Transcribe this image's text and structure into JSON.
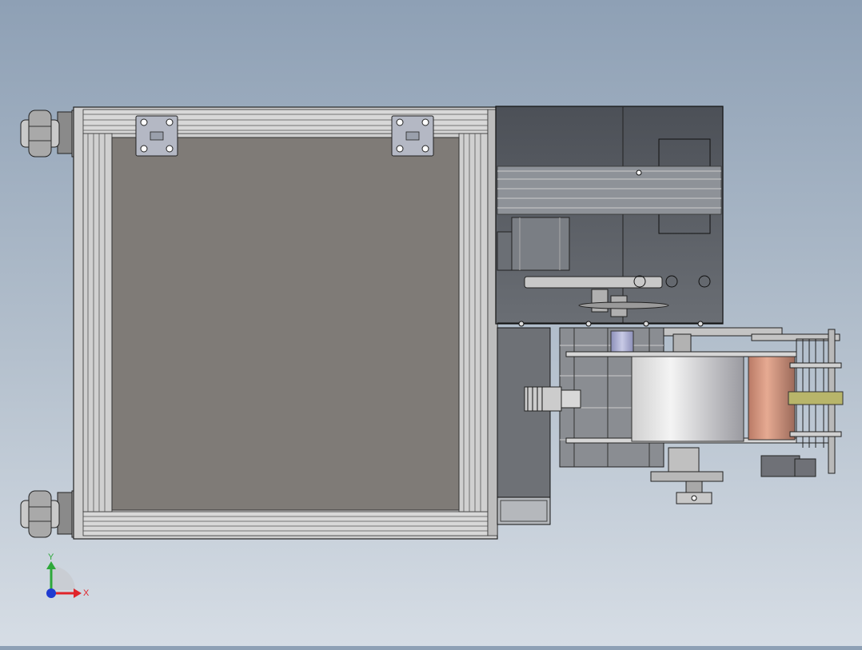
{
  "view": {
    "background_top": "#8ea0b5",
    "background_bottom": "#d6dde5"
  },
  "triad": {
    "x_label": "X",
    "y_label": "Y",
    "x_color": "#e0242a",
    "y_color": "#2ea83a",
    "z_color": "#1f3bd1"
  },
  "model": {
    "panel_color": "#7f7b77",
    "frame_color": "#c8c8c8",
    "housing_color": "#595d63",
    "roll_light_color": "#e8e8e8",
    "roll_copper_color": "#d99a82",
    "gear_color": "#b8b56a"
  }
}
